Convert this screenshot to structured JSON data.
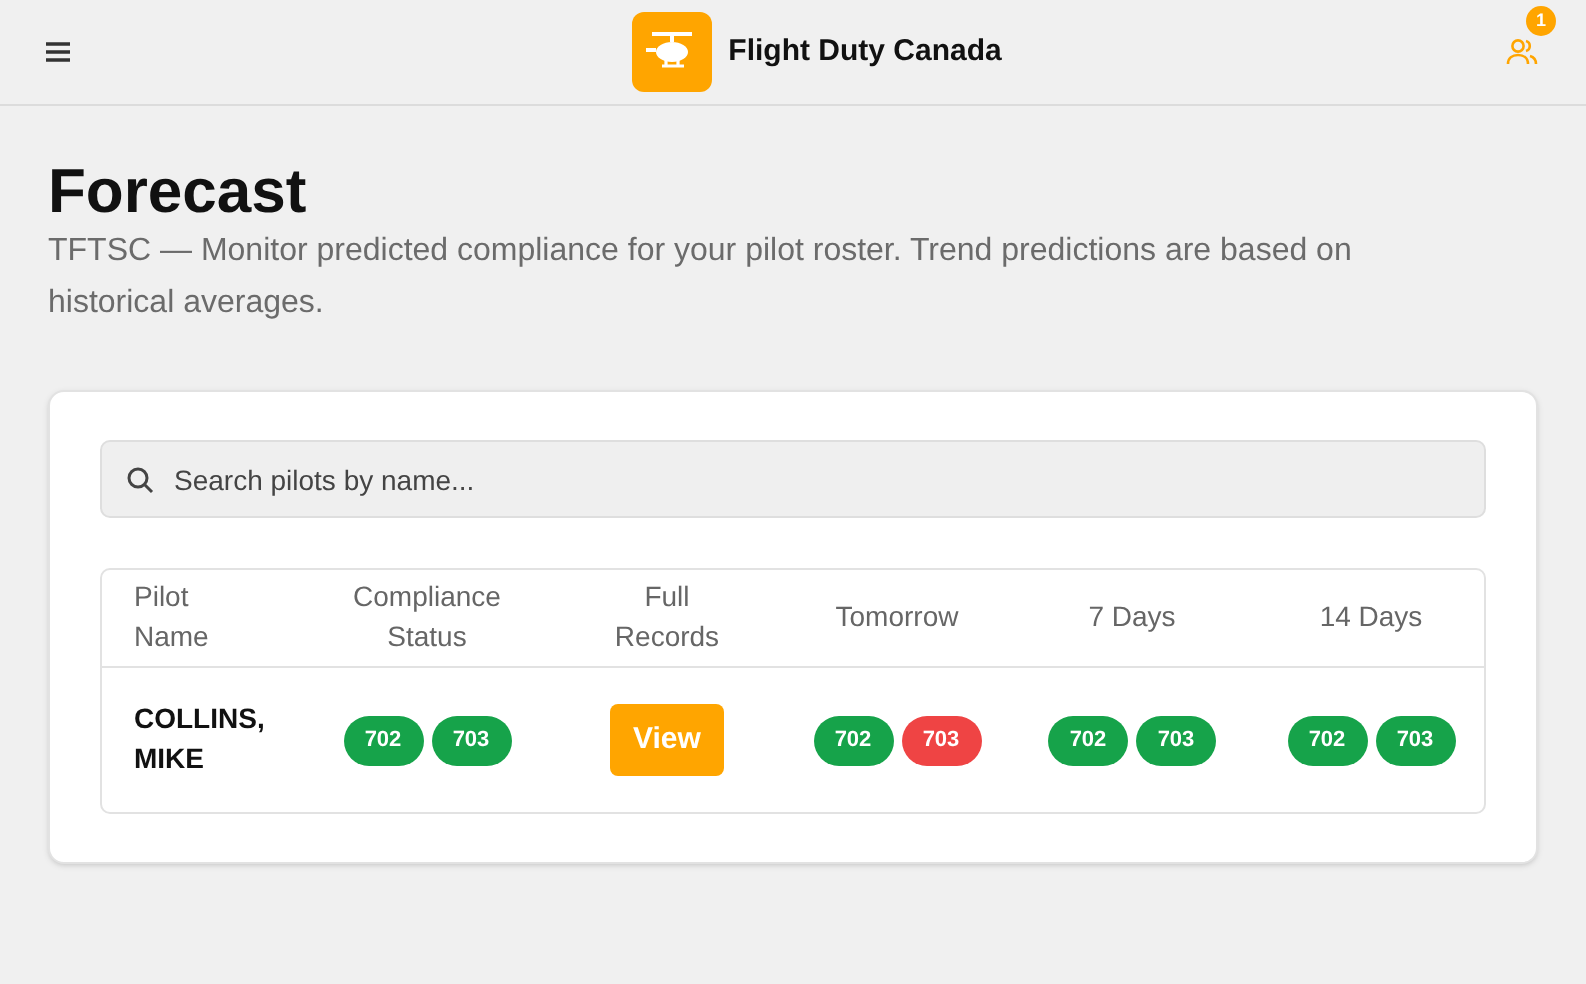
{
  "header": {
    "title": "Flight Duty Canada",
    "notification_count": "1"
  },
  "page": {
    "title": "Forecast",
    "description": "TFTSC — Monitor predicted compliance for your pilot roster. Trend predictions are based on historical averages."
  },
  "search": {
    "placeholder": "Search pilots by name..."
  },
  "table": {
    "columns": [
      "Pilot Name",
      "Compliance Status",
      "Full Records",
      "Tomorrow",
      "7 Days",
      "14 Days"
    ],
    "rows": [
      {
        "cells": [
          {
            "kind": "text",
            "text": "COLLINS, MIKE"
          },
          {
            "kind": "badges",
            "badges": [
              {
                "label": "702",
                "color": "#16a34a"
              },
              {
                "label": "703",
                "color": "#16a34a"
              }
            ]
          },
          {
            "kind": "button",
            "label": "View"
          },
          {
            "kind": "badges",
            "badges": [
              {
                "label": "702",
                "color": "#16a34a"
              },
              {
                "label": "703",
                "color": "#ef4444"
              }
            ]
          },
          {
            "kind": "badges",
            "badges": [
              {
                "label": "702",
                "color": "#16a34a"
              },
              {
                "label": "703",
                "color": "#16a34a"
              }
            ]
          },
          {
            "kind": "badges",
            "badges": [
              {
                "label": "702",
                "color": "#16a34a"
              },
              {
                "label": "703",
                "color": "#16a34a"
              }
            ]
          }
        ]
      }
    ]
  }
}
